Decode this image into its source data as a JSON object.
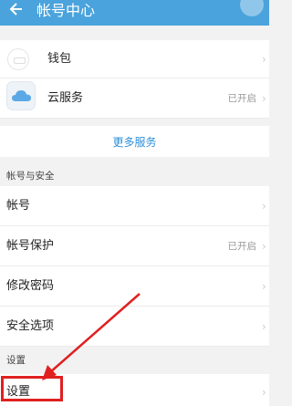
{
  "header": {
    "title": "帐号中心",
    "back_icon": "back-arrow-icon"
  },
  "services": {
    "wallet_label": "钱包",
    "cloud_label": "云服务",
    "cloud_status": "已开启",
    "more_label": "更多服务"
  },
  "account_security": {
    "section_title": "帐号与安全",
    "items": [
      {
        "label": "帐号",
        "value": ""
      },
      {
        "label": "帐号保护",
        "value": "已开启"
      },
      {
        "label": "修改密码",
        "value": ""
      },
      {
        "label": "安全选项",
        "value": ""
      }
    ]
  },
  "settings": {
    "section_title": "设置",
    "item_label": "设置"
  },
  "colors": {
    "header": "#4aa3dc",
    "link": "#2f8fd8",
    "annotation": "#e02020"
  }
}
